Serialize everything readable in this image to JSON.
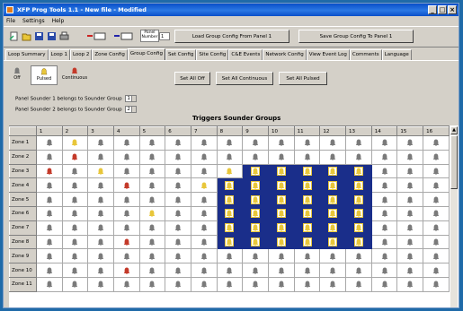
{
  "window": {
    "title": "XFP Prog Tools 1.1 - New file - Modified"
  },
  "menu": [
    "File",
    "Settings",
    "Help"
  ],
  "toolbar": {
    "panel_label": "Panel\nNumber",
    "panel_value": "1",
    "load_label": "Load Group Config From Panel 1",
    "save_label": "Save Group Config To Panel 1"
  },
  "tabs": [
    "Loop Summary",
    "Loop 1",
    "Loop 2",
    "Zone Config",
    "Group Config",
    "Set Config",
    "Site Config",
    "C&E Events",
    "Network Config",
    "View Event Log",
    "Comments",
    "Language"
  ],
  "active_tab": "Group Config",
  "modes": {
    "off": "Off",
    "pulsed": "Pulsed",
    "continuous": "Continuous"
  },
  "set_buttons": {
    "off": "Set All Off",
    "continuous": "Set All Continuous",
    "pulsed": "Set All Pulsed"
  },
  "sounder_groups": [
    {
      "label": "Panel Sounder 1 belongs to Sounder Group",
      "value": "1"
    },
    {
      "label": "Panel Sounder 2 belongs to Sounder Group",
      "value": "2"
    }
  ],
  "grid_heading": "Triggers Sounder Groups",
  "columns": [
    "1",
    "2",
    "3",
    "4",
    "5",
    "6",
    "7",
    "8",
    "9",
    "10",
    "11",
    "12",
    "13",
    "14",
    "15",
    "16"
  ],
  "rows": [
    "Zone 1",
    "Zone 2",
    "Zone 3",
    "Zone 4",
    "Zone 5",
    "Zone 6",
    "Zone 7",
    "Zone 8",
    "Zone 9",
    "Zone 10",
    "Zone 11"
  ],
  "cells": [
    "0100000000000000",
    "0200000000000000",
    "2010000110000000",
    "0002001000000000",
    "0000000000000000",
    "0000100000000000",
    "0000000000000000",
    "0002000000000000",
    "0000000000000000",
    "0002000000000000",
    "0000000000000000"
  ],
  "selection": {
    "first_row": 3,
    "last_row": 8,
    "first_col": 8,
    "last_col": 13,
    "notch_row": 3,
    "notch_first_col": 8
  },
  "colors": {
    "off": "#7a7a7a",
    "pulsed": "#e8c63a",
    "continuous": "#c43a2a",
    "selection": "#1a2e8a"
  }
}
